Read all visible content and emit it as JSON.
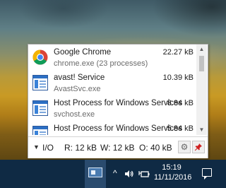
{
  "processes": [
    {
      "name": "Google Chrome",
      "sub": "chrome.exe (23 processes)",
      "size": "22.27 kB",
      "icon": "chrome-icon"
    },
    {
      "name": "avast! Service",
      "sub": "AvastSvc.exe",
      "size": "10.39 kB",
      "icon": "window-icon"
    },
    {
      "name": "Host Process for Windows Services",
      "sub": "svchost.exe",
      "size": "8.84 kB",
      "icon": "window-icon"
    },
    {
      "name": "Host Process for Windows Services",
      "sub": "",
      "size": "5.84 kB",
      "icon": "window-icon"
    }
  ],
  "footer": {
    "caret": "▼",
    "io_label": "I/O",
    "read": "R: 12 kB",
    "write": "W: 12 kB",
    "other": "O: 40 kB"
  },
  "scrollbar": {
    "up": "▲",
    "down": "▼"
  },
  "tray": {
    "chevron": "^",
    "time": "15:19",
    "date": "11/11/2016"
  },
  "colors": {
    "taskbar": "#0f2a44",
    "accent": "#2c6fc4"
  }
}
